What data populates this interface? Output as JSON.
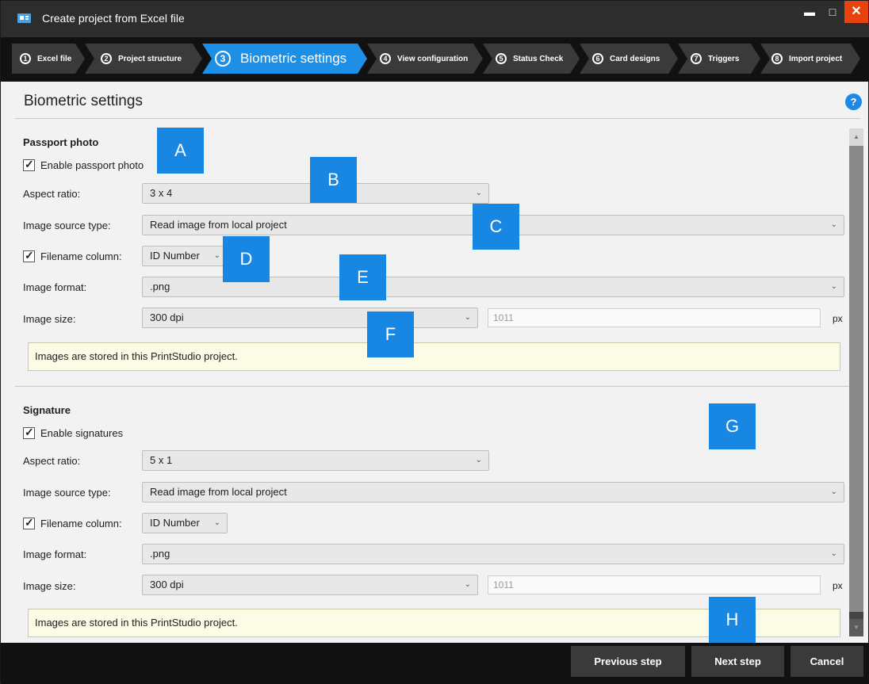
{
  "window": {
    "title": "Create project from Excel file",
    "minimize_glyph": "▬",
    "maximize_glyph": "□",
    "close_glyph": "✕"
  },
  "steps": [
    {
      "num": "1",
      "label": "Excel file"
    },
    {
      "num": "2",
      "label": "Project structure"
    },
    {
      "num": "3",
      "label": "Biometric settings"
    },
    {
      "num": "4",
      "label": "View configuration"
    },
    {
      "num": "5",
      "label": "Status Check"
    },
    {
      "num": "6",
      "label": "Card designs"
    },
    {
      "num": "7",
      "label": "Triggers"
    },
    {
      "num": "8",
      "label": "Import project"
    }
  ],
  "active_step_index": 2,
  "page": {
    "title": "Biometric settings",
    "help": "?"
  },
  "passport": {
    "title": "Passport photo",
    "enable_label": "Enable passport photo",
    "aspect_label": "Aspect ratio:",
    "aspect_value": "3 x 4",
    "source_label": "Image source type:",
    "source_value": "Read image from local project",
    "filename_label": "Filename column:",
    "filename_value": "ID Number",
    "format_label": "Image format:",
    "format_value": ".png",
    "size_label": "Image size:",
    "size_value": "300 dpi",
    "px_value": "1011",
    "px_unit": "px",
    "note": "Images are stored in this PrintStudio project."
  },
  "signature": {
    "title": "Signature",
    "enable_label": "Enable signatures",
    "aspect_label": "Aspect ratio:",
    "aspect_value": "5 x 1",
    "source_label": "Image source type:",
    "source_value": "Read image from local project",
    "filename_label": "Filename column:",
    "filename_value": "ID Number",
    "format_label": "Image format:",
    "format_value": ".png",
    "size_label": "Image size:",
    "size_value": "300 dpi",
    "px_value": "1011",
    "px_unit": "px",
    "note": "Images are stored in this PrintStudio project."
  },
  "footer": {
    "previous": "Previous step",
    "next": "Next step",
    "cancel": "Cancel"
  },
  "markers": [
    "A",
    "B",
    "C",
    "D",
    "E",
    "F",
    "G",
    "H"
  ],
  "colors": {
    "accent": "#1d8fe6",
    "marker": "#1787e3",
    "close": "#e8420e"
  }
}
